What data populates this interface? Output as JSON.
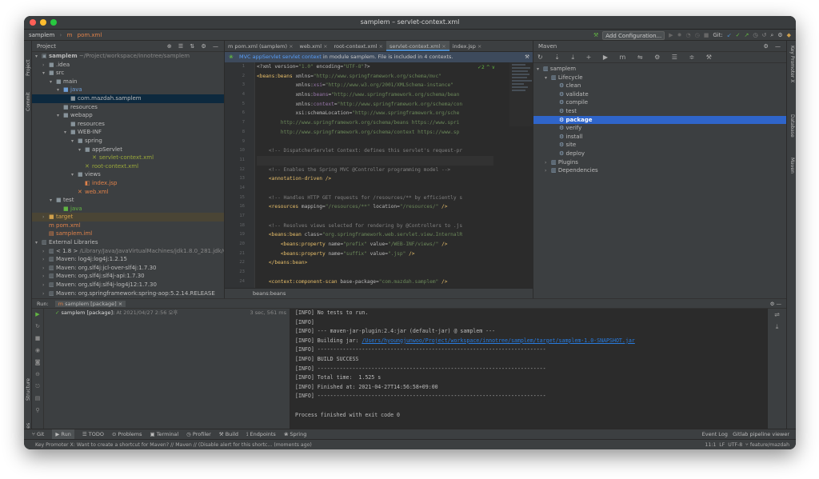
{
  "window": {
    "title": "samplem – servlet-context.xml"
  },
  "nav": {
    "project": "samplem",
    "file": "pom.xml",
    "add_config": "Add Configuration...",
    "git_label": "Git:"
  },
  "left_strip": {
    "project": "Project",
    "commit": "Commit",
    "structure": "Structure",
    "favorites": "Favorites"
  },
  "right_strip": {
    "key_promoter": "Key Promoter X",
    "database": "Database",
    "maven": "Maven"
  },
  "project_panel": {
    "title": "Project",
    "tree": [
      {
        "indent": 0,
        "arrow": "▾",
        "icon": "▣",
        "label": "samplem",
        "extra": " ~/Project/workspace/innotree/samplem",
        "bold": true
      },
      {
        "indent": 1,
        "arrow": "›",
        "icon": "■",
        "label": ".idea"
      },
      {
        "indent": 1,
        "arrow": "▾",
        "icon": "■",
        "label": "src"
      },
      {
        "indent": 2,
        "arrow": "▾",
        "icon": "■",
        "label": "main"
      },
      {
        "indent": 3,
        "arrow": "▾",
        "icon": "■",
        "label": "java",
        "color": "#6f9fd8"
      },
      {
        "indent": 4,
        "arrow": "",
        "icon": "■",
        "label": "com.mazdah.samplem",
        "sel": true
      },
      {
        "indent": 3,
        "arrow": "",
        "icon": "■",
        "label": "resources"
      },
      {
        "indent": 3,
        "arrow": "▾",
        "icon": "■",
        "label": "webapp"
      },
      {
        "indent": 4,
        "arrow": "",
        "icon": "■",
        "label": "resources"
      },
      {
        "indent": 4,
        "arrow": "▾",
        "icon": "■",
        "label": "WEB-INF"
      },
      {
        "indent": 5,
        "arrow": "▾",
        "icon": "■",
        "label": "spring"
      },
      {
        "indent": 6,
        "arrow": "▾",
        "icon": "■",
        "label": "appServlet"
      },
      {
        "indent": 7,
        "arrow": "",
        "icon": "✕",
        "label": "servlet-context.xml",
        "color": "#9aa83a"
      },
      {
        "indent": 6,
        "arrow": "",
        "icon": "✕",
        "label": "root-context.xml",
        "color": "#9aa83a"
      },
      {
        "indent": 5,
        "arrow": "▾",
        "icon": "■",
        "label": "views"
      },
      {
        "indent": 6,
        "arrow": "",
        "icon": "◧",
        "label": "index.jsp",
        "color": "#e0824a"
      },
      {
        "indent": 5,
        "arrow": "",
        "icon": "✕",
        "label": "web.xml",
        "color": "#e0824a"
      },
      {
        "indent": 2,
        "arrow": "▾",
        "icon": "■",
        "label": "test"
      },
      {
        "indent": 3,
        "arrow": "",
        "icon": "■",
        "label": "java",
        "color": "#62b543"
      },
      {
        "indent": 1,
        "arrow": "›",
        "icon": "■",
        "label": "target",
        "color": "#d0a04b",
        "mark": true
      },
      {
        "indent": 1,
        "arrow": "",
        "icon": "m",
        "label": "pom.xml",
        "color": "#e0824a"
      },
      {
        "indent": 1,
        "arrow": "",
        "icon": "▤",
        "label": "samplem.iml",
        "color": "#e0824a"
      },
      {
        "indent": 0,
        "arrow": "▾",
        "icon": "▥",
        "label": "External Libraries"
      },
      {
        "indent": 1,
        "arrow": "›",
        "icon": "▥",
        "label": "< 1.8 >",
        "extra": " /Library/Java/JavaVirtualMachines/jdk1.8.0_281.jdk/Cont"
      },
      {
        "indent": 1,
        "arrow": "›",
        "icon": "▥",
        "label": "Maven: log4j:log4j:1.2.15"
      },
      {
        "indent": 1,
        "arrow": "›",
        "icon": "▥",
        "label": "Maven: org.slf4j:jcl-over-slf4j:1.7.30"
      },
      {
        "indent": 1,
        "arrow": "›",
        "icon": "▥",
        "label": "Maven: org.slf4j:slf4j-api:1.7.30"
      },
      {
        "indent": 1,
        "arrow": "›",
        "icon": "▥",
        "label": "Maven: org.slf4j:slf4j-log4j12:1.7.30"
      },
      {
        "indent": 1,
        "arrow": "›",
        "icon": "▥",
        "label": "Maven: org.springframework:spring-aop:5.2.14.RELEASE"
      }
    ]
  },
  "editor": {
    "tabs": [
      {
        "label": "m pom.xml (samplem)",
        "active": false
      },
      {
        "label": "web.xml",
        "active": false
      },
      {
        "label": "root-context.xml",
        "active": false
      },
      {
        "label": "servlet-context.xml",
        "active": true
      },
      {
        "label": "index.jsp",
        "active": false
      }
    ],
    "banner_ctx": "MVC appServlet servlet context",
    "banner_msg": " in module samplem. File is included in 4 contexts.",
    "inspection": "✓2 ^ ∨",
    "breadcrumb": "beans:beans",
    "lines": [
      {
        "n": "1",
        "html": "<span class=\"at\">&lt;?xml version=</span><span class=\"st\">\"1.0\"</span><span class=\"at\"> encoding=</span><span class=\"st\">\"UTF-8\"</span><span class=\"at\">?&gt;</span>"
      },
      {
        "n": "2",
        "html": "<span class=\"kw\">&lt;beans:beans</span> <span class=\"at\">xmlns=</span><span class=\"st\">\"http://www.springframework.org/schema/mvc\"</span>"
      },
      {
        "n": "3",
        "html": "             <span class=\"at\">xmlns:</span><span class=\"ns\">xsi</span><span class=\"at\">=</span><span class=\"st\">\"http://www.w3.org/2001/XMLSchema-instance\"</span>"
      },
      {
        "n": "4",
        "html": "             <span class=\"at\">xmlns:</span><span class=\"ns\">beans</span><span class=\"at\">=</span><span class=\"st\">\"http://www.springframework.org/schema/bean</span>"
      },
      {
        "n": "5",
        "html": "             <span class=\"at\">xmlns:</span><span class=\"ns\">context</span><span class=\"at\">=</span><span class=\"st\">\"http://www.springframework.org/schema/con</span>"
      },
      {
        "n": "6",
        "html": "             <span class=\"at\">xsi:schemaLocation=</span><span class=\"st\">\"http://www.springframework.org/sche</span>"
      },
      {
        "n": "7",
        "html": "        <span class=\"st\">http://www.springframework.org/schema/beans https://www.spri</span>"
      },
      {
        "n": "8",
        "html": "        <span class=\"st\">http://www.springframework.org/schema/context https://www.sp</span>"
      },
      {
        "n": "9",
        "html": ""
      },
      {
        "n": "10",
        "html": "    <span class=\"cm\">&lt;!-- DispatcherServlet Context: defines this servlet's request-pr</span>"
      },
      {
        "n": "11",
        "html": "",
        "cur": true
      },
      {
        "n": "12",
        "html": "    <span class=\"cm\">&lt;!-- Enables the Spring MVC @Controller programming model --&gt;</span>"
      },
      {
        "n": "13",
        "html": "    <span class=\"kw\">&lt;annotation-driven</span> <span class=\"kw\">/&gt;</span>"
      },
      {
        "n": "14",
        "html": ""
      },
      {
        "n": "15",
        "html": "    <span class=\"cm\">&lt;!-- Handles HTTP GET requests for /resources/** by efficiently s</span>"
      },
      {
        "n": "16",
        "html": "    <span class=\"kw\">&lt;resources</span> <span class=\"at\">mapping=</span><span class=\"st\">\"/resources/**\"</span> <span class=\"at\">location=</span><span class=\"st\">\"/resources/\"</span> <span class=\"kw\">/&gt;</span>"
      },
      {
        "n": "17",
        "html": ""
      },
      {
        "n": "18",
        "html": "    <span class=\"cm\">&lt;!-- Resolves views selected for rendering by @Controllers to .js</span>"
      },
      {
        "n": "19",
        "html": "    <span class=\"kw\">&lt;beans:bean</span> <span class=\"at\">class=</span><span class=\"st\">\"org.springframework.web.servlet.view.InternalR</span>"
      },
      {
        "n": "20",
        "html": "        <span class=\"kw\">&lt;beans:property</span> <span class=\"at\">name=</span><span class=\"st\">\"prefix\"</span> <span class=\"at\">value=</span><span class=\"st\">\"/WEB-INF/views/\"</span> <span class=\"kw\">/&gt;</span>"
      },
      {
        "n": "21",
        "html": "        <span class=\"kw\">&lt;beans:property</span> <span class=\"at\">name=</span><span class=\"st\">\"suffix\"</span> <span class=\"at\">value=</span><span class=\"st\">\".jsp\"</span> <span class=\"kw\">/&gt;</span>"
      },
      {
        "n": "22",
        "html": "    <span class=\"kw\">&lt;/beans:bean&gt;</span>"
      },
      {
        "n": "23",
        "html": ""
      },
      {
        "n": "24",
        "html": "    <span class=\"kw\">&lt;context:component-scan</span> <span class=\"at\">base-package=</span><span class=\"st\">\"com.mazdah.samplem\"</span> <span class=\"kw\">/&gt;</span>"
      }
    ]
  },
  "maven": {
    "title": "Maven",
    "tree": [
      {
        "indent": 0,
        "arrow": "▾",
        "icon": "▥",
        "label": "samplem"
      },
      {
        "indent": 1,
        "arrow": "▾",
        "icon": "▥",
        "label": "Lifecycle"
      },
      {
        "indent": 2,
        "arrow": "",
        "icon": "⚙",
        "label": "clean"
      },
      {
        "indent": 2,
        "arrow": "",
        "icon": "⚙",
        "label": "validate"
      },
      {
        "indent": 2,
        "arrow": "",
        "icon": "⚙",
        "label": "compile"
      },
      {
        "indent": 2,
        "arrow": "",
        "icon": "⚙",
        "label": "test"
      },
      {
        "indent": 2,
        "arrow": "",
        "icon": "⚙",
        "label": "package",
        "sel": true
      },
      {
        "indent": 2,
        "arrow": "",
        "icon": "⚙",
        "label": "verify"
      },
      {
        "indent": 2,
        "arrow": "",
        "icon": "⚙",
        "label": "install"
      },
      {
        "indent": 2,
        "arrow": "",
        "icon": "⚙",
        "label": "site"
      },
      {
        "indent": 2,
        "arrow": "",
        "icon": "⚙",
        "label": "deploy"
      },
      {
        "indent": 1,
        "arrow": "›",
        "icon": "▥",
        "label": "Plugins"
      },
      {
        "indent": 1,
        "arrow": "›",
        "icon": "▥",
        "label": "Dependencies"
      }
    ]
  },
  "run": {
    "label": "Run:",
    "tab": "samplem [package]",
    "item": "samplem [package]:",
    "item_time": " At 2021/04/27 2:56 오후",
    "duration": "3 sec, 561 ms",
    "console": [
      {
        "text": "[INFO] No tests to run."
      },
      {
        "text": "[INFO]"
      },
      {
        "text": "[INFO] --- maven-jar-plugin:2.4:jar (default-jar) @ samplem ---"
      },
      {
        "text": "[INFO] Building jar: ",
        "link": "/Users/hyoungjunwoo/Project/workspace/innotree/samplem/target/samplem-1.0-SNAPSHOT.jar"
      },
      {
        "text": "[INFO] ------------------------------------------------------------------------"
      },
      {
        "text": "[INFO] BUILD SUCCESS"
      },
      {
        "text": "[INFO] ------------------------------------------------------------------------"
      },
      {
        "text": "[INFO] Total time:  1.525 s"
      },
      {
        "text": "[INFO] Finished at: 2021-04-27T14:56:58+09:00"
      },
      {
        "text": "[INFO] ------------------------------------------------------------------------"
      },
      {
        "text": ""
      },
      {
        "text": "Process finished with exit code 0"
      }
    ]
  },
  "bottom_tabs": [
    {
      "label": "⑂ Git",
      "active": false
    },
    {
      "label": "▶ Run",
      "active": true
    },
    {
      "label": "☰ TODO",
      "active": false
    },
    {
      "label": "⊙ Problems",
      "active": false
    },
    {
      "label": "▣ Terminal",
      "active": false
    },
    {
      "label": "◷ Profiler",
      "active": false
    },
    {
      "label": "⚒ Build",
      "active": false
    },
    {
      "label": "⟟ Endpoints",
      "active": false
    },
    {
      "label": "❀ Spring",
      "active": false
    }
  ],
  "bottom_right": {
    "event_log": "Event Log",
    "gitlab": "Gitlab pipeline viewer"
  },
  "status": {
    "message": "Key Promoter X: Want to create a shortcut for Maven? // Maven // (Disable alert for this shortc... (moments ago)",
    "position": "11:1",
    "line_sep": "LF",
    "encoding": "UTF-8",
    "branch": "feature/mazdah"
  },
  "colors": {
    "accent": "#2f65ca",
    "selected_tree": "#0d293e"
  }
}
